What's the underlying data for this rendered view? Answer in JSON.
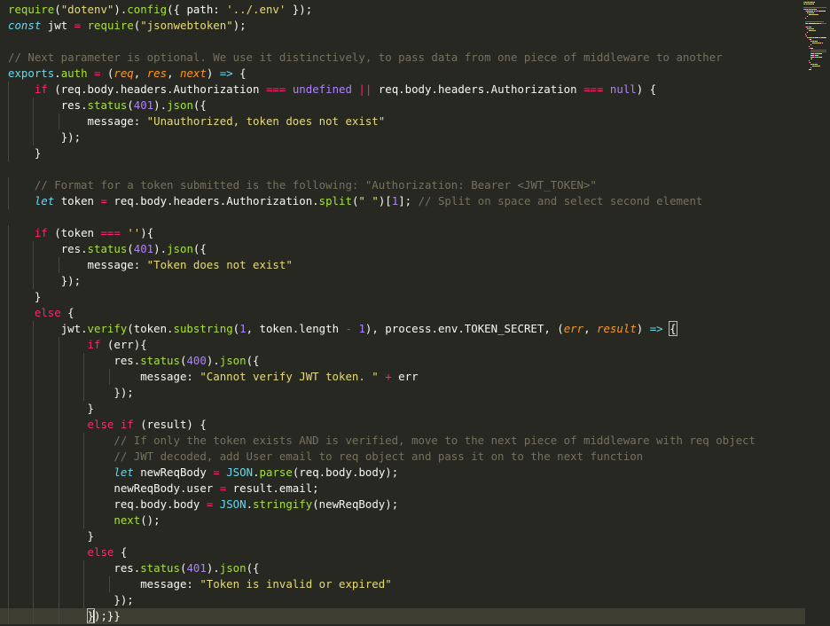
{
  "editor": {
    "lines": [
      {
        "indent": 0,
        "tokens": [
          [
            "fn",
            "require"
          ],
          [
            "pl",
            "("
          ],
          [
            "str",
            "\"dotenv\""
          ],
          [
            "pl",
            ")."
          ],
          [
            "fn",
            "config"
          ],
          [
            "pl",
            "({ path: "
          ],
          [
            "str",
            "'../.env'"
          ],
          [
            "pl",
            " });"
          ]
        ]
      },
      {
        "indent": 0,
        "tokens": [
          [
            "kwi",
            "const"
          ],
          [
            "pl",
            " jwt "
          ],
          [
            "op",
            "="
          ],
          [
            "pl",
            " "
          ],
          [
            "fn",
            "require"
          ],
          [
            "pl",
            "("
          ],
          [
            "str",
            "\"jsonwebtoken\""
          ],
          [
            "pl",
            ");"
          ]
        ]
      },
      {
        "indent": 0,
        "tokens": []
      },
      {
        "indent": 0,
        "tokens": [
          [
            "cm",
            "// Next parameter is optional. We use it distinctively, to pass data from one piece of middleware to another"
          ]
        ]
      },
      {
        "indent": 0,
        "tokens": [
          [
            "lib",
            "exports"
          ],
          [
            "pl",
            "."
          ],
          [
            "fn",
            "auth"
          ],
          [
            "pl",
            " "
          ],
          [
            "op",
            "="
          ],
          [
            "pl",
            " ("
          ],
          [
            "prm",
            "req"
          ],
          [
            "pl",
            ", "
          ],
          [
            "prm",
            "res"
          ],
          [
            "pl",
            ", "
          ],
          [
            "prm",
            "next"
          ],
          [
            "pl",
            ") "
          ],
          [
            "kwi",
            "=>"
          ],
          [
            "pl",
            " {"
          ]
        ]
      },
      {
        "indent": 1,
        "tokens": [
          [
            "kw",
            "if"
          ],
          [
            "pl",
            " (req.body.headers.Authorization "
          ],
          [
            "op",
            "==="
          ],
          [
            "pl",
            " "
          ],
          [
            "num",
            "undefined"
          ],
          [
            "pl",
            " "
          ],
          [
            "op",
            "||"
          ],
          [
            "pl",
            " req.body.headers.Authorization "
          ],
          [
            "op",
            "==="
          ],
          [
            "pl",
            " "
          ],
          [
            "num",
            "null"
          ],
          [
            "pl",
            ") {"
          ]
        ]
      },
      {
        "indent": 2,
        "tokens": [
          [
            "pl",
            "res."
          ],
          [
            "fn",
            "status"
          ],
          [
            "pl",
            "("
          ],
          [
            "num",
            "401"
          ],
          [
            "pl",
            ")."
          ],
          [
            "fn",
            "json"
          ],
          [
            "pl",
            "({"
          ]
        ]
      },
      {
        "indent": 3,
        "tokens": [
          [
            "pl",
            "message: "
          ],
          [
            "str",
            "\"Unauthorized, token does not exist\""
          ]
        ]
      },
      {
        "indent": 2,
        "tokens": [
          [
            "pl",
            "});"
          ]
        ]
      },
      {
        "indent": 1,
        "tokens": [
          [
            "pl",
            "}"
          ]
        ]
      },
      {
        "indent": 0,
        "tokens": []
      },
      {
        "indent": 1,
        "tokens": [
          [
            "cm",
            "// Format for a token submitted is the following: \"Authorization: Bearer <JWT_TOKEN>\""
          ]
        ]
      },
      {
        "indent": 1,
        "tokens": [
          [
            "kwi",
            "let"
          ],
          [
            "pl",
            " token "
          ],
          [
            "op",
            "="
          ],
          [
            "pl",
            " req.body.headers.Authorization."
          ],
          [
            "fn",
            "split"
          ],
          [
            "pl",
            "("
          ],
          [
            "str",
            "\" \""
          ],
          [
            "pl",
            ")["
          ],
          [
            "num",
            "1"
          ],
          [
            "pl",
            "]; "
          ],
          [
            "cm",
            "// Split on space and select second element"
          ]
        ]
      },
      {
        "indent": 0,
        "tokens": []
      },
      {
        "indent": 1,
        "tokens": [
          [
            "kw",
            "if"
          ],
          [
            "pl",
            " (token "
          ],
          [
            "op",
            "==="
          ],
          [
            "pl",
            " "
          ],
          [
            "str",
            "''"
          ],
          [
            "pl",
            "){"
          ]
        ]
      },
      {
        "indent": 2,
        "tokens": [
          [
            "pl",
            "res."
          ],
          [
            "fn",
            "status"
          ],
          [
            "pl",
            "("
          ],
          [
            "num",
            "401"
          ],
          [
            "pl",
            ")."
          ],
          [
            "fn",
            "json"
          ],
          [
            "pl",
            "({"
          ]
        ]
      },
      {
        "indent": 3,
        "tokens": [
          [
            "pl",
            "message: "
          ],
          [
            "str",
            "\"Token does not exist\""
          ]
        ]
      },
      {
        "indent": 2,
        "tokens": [
          [
            "pl",
            "});"
          ]
        ]
      },
      {
        "indent": 1,
        "tokens": [
          [
            "pl",
            "}"
          ]
        ]
      },
      {
        "indent": 1,
        "tokens": [
          [
            "kw",
            "else"
          ],
          [
            "pl",
            " {"
          ]
        ]
      },
      {
        "indent": 2,
        "tokens": [
          [
            "pl",
            "jwt."
          ],
          [
            "fn",
            "verify"
          ],
          [
            "pl",
            "(token."
          ],
          [
            "fn",
            "substring"
          ],
          [
            "pl",
            "("
          ],
          [
            "num",
            "1"
          ],
          [
            "pl",
            ", token.length "
          ],
          [
            "op",
            "-"
          ],
          [
            "pl",
            " "
          ],
          [
            "num",
            "1"
          ],
          [
            "pl",
            "), process.env.TOKEN_SECRET, ("
          ],
          [
            "prm",
            "err"
          ],
          [
            "pl",
            ", "
          ],
          [
            "prm",
            "result"
          ],
          [
            "pl",
            ") "
          ],
          [
            "kwi",
            "=>"
          ],
          [
            "pl",
            " "
          ],
          [
            "brk",
            "{"
          ]
        ]
      },
      {
        "indent": 3,
        "tokens": [
          [
            "kw",
            "if"
          ],
          [
            "pl",
            " (err){"
          ]
        ]
      },
      {
        "indent": 4,
        "tokens": [
          [
            "pl",
            "res."
          ],
          [
            "fn",
            "status"
          ],
          [
            "pl",
            "("
          ],
          [
            "num",
            "400"
          ],
          [
            "pl",
            ")."
          ],
          [
            "fn",
            "json"
          ],
          [
            "pl",
            "({"
          ]
        ]
      },
      {
        "indent": 5,
        "tokens": [
          [
            "pl",
            "message: "
          ],
          [
            "str",
            "\"Cannot verify JWT token. \""
          ],
          [
            "pl",
            " "
          ],
          [
            "op",
            "+"
          ],
          [
            "pl",
            " err"
          ]
        ]
      },
      {
        "indent": 4,
        "tokens": [
          [
            "pl",
            "});"
          ]
        ]
      },
      {
        "indent": 3,
        "tokens": [
          [
            "pl",
            "}"
          ]
        ]
      },
      {
        "indent": 3,
        "tokens": [
          [
            "kw",
            "else if"
          ],
          [
            "pl",
            " (result) {"
          ]
        ]
      },
      {
        "indent": 4,
        "tokens": [
          [
            "cm",
            "// If only the token exists AND is verified, move to the next piece of middleware with req object"
          ]
        ]
      },
      {
        "indent": 4,
        "tokens": [
          [
            "cm",
            "// JWT decoded, add User email to req object and pass it on to the next function"
          ]
        ]
      },
      {
        "indent": 4,
        "tokens": [
          [
            "kwi",
            "let"
          ],
          [
            "pl",
            " newReqBody "
          ],
          [
            "op",
            "="
          ],
          [
            "pl",
            " "
          ],
          [
            "lib",
            "JSON"
          ],
          [
            "pl",
            "."
          ],
          [
            "fn",
            "parse"
          ],
          [
            "pl",
            "(req.body.body);"
          ]
        ]
      },
      {
        "indent": 4,
        "tokens": [
          [
            "pl",
            "newReqBody.user "
          ],
          [
            "op",
            "="
          ],
          [
            "pl",
            " result.email;"
          ]
        ]
      },
      {
        "indent": 4,
        "tokens": [
          [
            "pl",
            "req.body.body "
          ],
          [
            "op",
            "="
          ],
          [
            "pl",
            " "
          ],
          [
            "lib",
            "JSON"
          ],
          [
            "pl",
            "."
          ],
          [
            "fn",
            "stringify"
          ],
          [
            "pl",
            "(newReqBody);"
          ]
        ]
      },
      {
        "indent": 4,
        "tokens": [
          [
            "fn",
            "next"
          ],
          [
            "pl",
            "();"
          ]
        ]
      },
      {
        "indent": 3,
        "tokens": [
          [
            "pl",
            "}"
          ]
        ]
      },
      {
        "indent": 3,
        "tokens": [
          [
            "kw",
            "else"
          ],
          [
            "pl",
            " {"
          ]
        ]
      },
      {
        "indent": 4,
        "tokens": [
          [
            "pl",
            "res."
          ],
          [
            "fn",
            "status"
          ],
          [
            "pl",
            "("
          ],
          [
            "num",
            "401"
          ],
          [
            "pl",
            ")."
          ],
          [
            "fn",
            "json"
          ],
          [
            "pl",
            "({"
          ]
        ]
      },
      {
        "indent": 5,
        "tokens": [
          [
            "pl",
            "message: "
          ],
          [
            "str",
            "\"Token is invalid or expired\""
          ]
        ]
      },
      {
        "indent": 4,
        "tokens": [
          [
            "pl",
            "});"
          ]
        ]
      },
      {
        "indent": 3,
        "tokens": [
          [
            "brk",
            "}"
          ],
          [
            "caret",
            ""
          ],
          [
            "pl",
            ");"
          ],
          [
            "pl",
            "}}"
          ]
        ],
        "current": true
      }
    ]
  },
  "colors": {
    "background": "#272822",
    "current_line": "#3e3d32",
    "keyword": "#f92672",
    "storage": "#66d9ef",
    "function": "#a6e22e",
    "string": "#e6db74",
    "number": "#ae81ff",
    "comment": "#75715e",
    "parameter": "#fd971f"
  }
}
